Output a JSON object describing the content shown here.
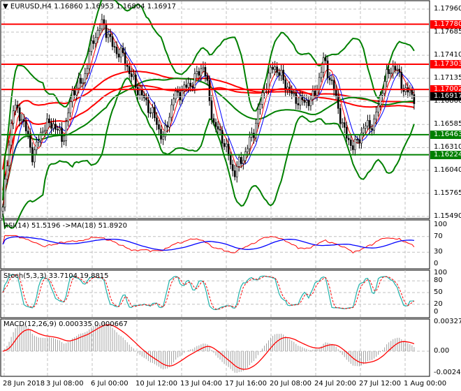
{
  "header": {
    "symbol": "EURUSD,H4",
    "ohlc": "1.16860 1.16953 1.16804 1.16917",
    "menu_icon": "triangle-down-icon"
  },
  "colors": {
    "bull": "#ffffff",
    "bear": "#000000",
    "bands": "#008000",
    "resistance": "#ff0000",
    "support": "#008000",
    "rsi": "#ff0000",
    "rsi_ma": "#0000ff",
    "stoch_main": "#20b2aa",
    "stoch_signal": "#ff0000",
    "macd_hist": "#a0a0a0",
    "macd_signal": "#ff0000"
  },
  "chart_data": [
    {
      "type": "candlestick",
      "title": "EURUSD,H4",
      "price_axis": [
        "1.17960",
        "1.17685",
        "1.17410",
        "1.17135",
        "1.16860",
        "1.16585",
        "1.16310",
        "1.16040",
        "1.15765",
        "1.15490"
      ],
      "ylim": [
        1.1549,
        1.1796
      ],
      "levels": [
        {
          "value": "1.17780",
          "kind": "resistance"
        },
        {
          "value": "1.17303",
          "kind": "resistance"
        },
        {
          "value": "1.17002",
          "kind": "resistance"
        },
        {
          "value": "1.16463",
          "kind": "support"
        },
        {
          "value": "1.16224",
          "kind": "support"
        }
      ],
      "current_price": "1.16917",
      "approx_close_path": [
        1.156,
        1.168,
        1.1665,
        1.162,
        1.1655,
        1.166,
        1.164,
        1.17,
        1.171,
        1.176,
        1.178,
        1.175,
        1.174,
        1.171,
        1.169,
        1.167,
        1.164,
        1.169,
        1.17,
        1.171,
        1.173,
        1.166,
        1.164,
        1.16,
        1.162,
        1.165,
        1.17,
        1.173,
        1.171,
        1.169,
        1.1685,
        1.169,
        1.1735,
        1.17,
        1.165,
        1.163,
        1.1655,
        1.166,
        1.171,
        1.173,
        1.17,
        1.1692
      ],
      "x_ticks": [
        "28 Jun 2018",
        "3 Jul 08:00",
        "6 Jul 00:00",
        "10 Jul 12:00",
        "13 Jul 04:00",
        "17 Jul 16:00",
        "20 Jul 08:00",
        "24 Jul 20:00",
        "27 Jul 12:00",
        "1 Aug 00:00"
      ],
      "grid": true
    },
    {
      "type": "line",
      "title": "RSI(14) 51.5196  ->MA(18) 51.8920",
      "y_ticks": [
        "100",
        "70",
        "30",
        "0"
      ],
      "ylim": [
        0,
        100
      ]
    },
    {
      "type": "line",
      "title": "Stoch(5,3,3) 33.7104 19.8815",
      "y_ticks": [
        "100",
        "80",
        "50",
        "20",
        "0"
      ],
      "ylim": [
        0,
        100
      ]
    },
    {
      "type": "bar",
      "title": "MACD(12,26,9) 0.000335 0.000667",
      "y_ticks": [
        "0.003273",
        "0.00",
        "-0.002436"
      ],
      "ylim": [
        -0.002436,
        0.003273
      ]
    }
  ]
}
